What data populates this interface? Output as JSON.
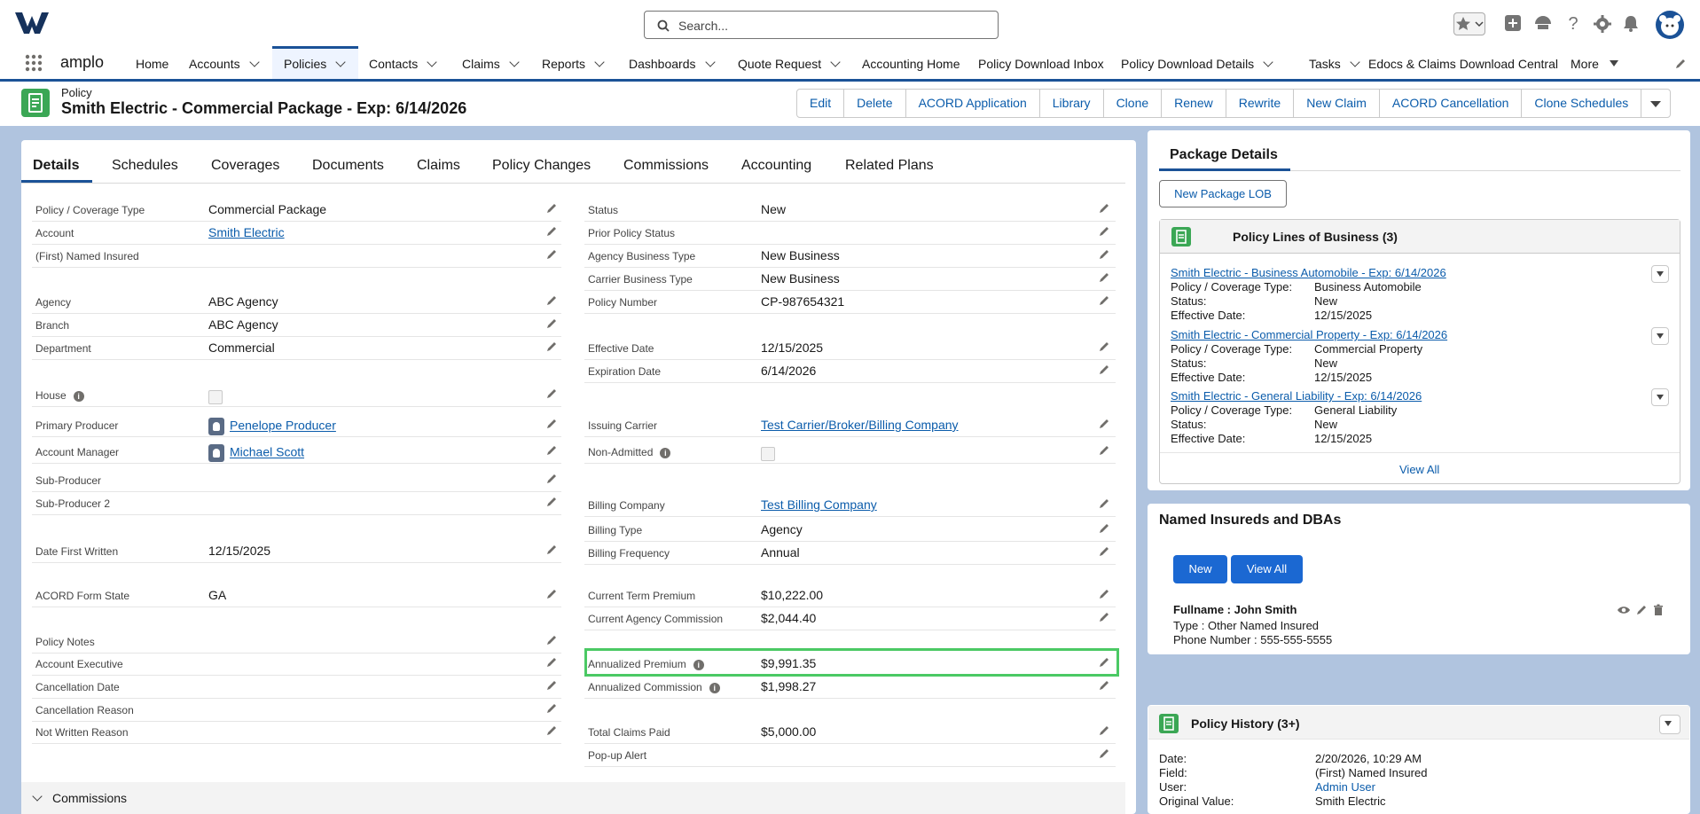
{
  "header": {
    "search_placeholder": "Search...",
    "app_name": "amplo"
  },
  "nav": {
    "items": [
      "Home",
      "Accounts",
      "Policies",
      "Contacts",
      "Claims",
      "Reports",
      "Dashboards",
      "Quote Request",
      "Accounting Home",
      "Policy Download Inbox",
      "Policy Download Details",
      "Tasks",
      "Edocs & Claims Download Central",
      "More"
    ]
  },
  "record": {
    "object_label": "Policy",
    "title": "Smith Electric - Commercial Package - Exp: 6/14/2026",
    "actions": [
      "Edit",
      "Delete",
      "ACORD Application",
      "Library",
      "Clone",
      "Renew",
      "Rewrite",
      "New Claim",
      "ACORD Cancellation",
      "Clone Schedules"
    ]
  },
  "tabs": [
    "Details",
    "Schedules",
    "Coverages",
    "Documents",
    "Claims",
    "Policy Changes",
    "Commissions",
    "Accounting",
    "Related Plans"
  ],
  "left_fields": [
    {
      "label": "Policy / Coverage Type",
      "value": "Commercial Package"
    },
    {
      "label": "Account",
      "value": "Smith Electric"
    },
    {
      "label": "(First) Named Insured",
      "value": ""
    },
    {
      "label": "Agency",
      "value": "ABC Agency"
    },
    {
      "label": "Branch",
      "value": "ABC Agency"
    },
    {
      "label": "Department",
      "value": "Commercial"
    },
    {
      "label": "House",
      "value": ""
    },
    {
      "label": "Primary Producer",
      "value": "Penelope Producer"
    },
    {
      "label": "Account Manager",
      "value": "Michael Scott"
    },
    {
      "label": "Sub-Producer",
      "value": ""
    },
    {
      "label": "Sub-Producer 2",
      "value": ""
    },
    {
      "label": "Date First Written",
      "value": "12/15/2025"
    },
    {
      "label": "ACORD Form State",
      "value": "GA"
    },
    {
      "label": "Policy Notes",
      "value": ""
    },
    {
      "label": "Account Executive",
      "value": ""
    },
    {
      "label": "Cancellation Date",
      "value": ""
    },
    {
      "label": "Cancellation Reason",
      "value": ""
    },
    {
      "label": "Not Written Reason",
      "value": ""
    }
  ],
  "right_fields": [
    {
      "label": "Status",
      "value": "New"
    },
    {
      "label": "Prior Policy Status",
      "value": ""
    },
    {
      "label": "Agency Business Type",
      "value": "New Business"
    },
    {
      "label": "Carrier Business Type",
      "value": "New Business"
    },
    {
      "label": "Policy Number",
      "value": "CP-987654321"
    },
    {
      "label": "Effective Date",
      "value": "12/15/2025"
    },
    {
      "label": "Expiration Date",
      "value": "6/14/2026"
    },
    {
      "label": "Issuing Carrier",
      "value": "Test Carrier/Broker/Billing Company"
    },
    {
      "label": "Non-Admitted",
      "value": ""
    },
    {
      "label": "Billing Company",
      "value": "Test Billing Company"
    },
    {
      "label": "Billing Type",
      "value": "Agency"
    },
    {
      "label": "Billing Frequency",
      "value": "Annual"
    },
    {
      "label": "Current Term Premium",
      "value": "$10,222.00"
    },
    {
      "label": "Current Agency Commission",
      "value": "$2,044.40"
    },
    {
      "label": "Annualized Premium",
      "value": "$9,991.35"
    },
    {
      "label": "Annualized Commission",
      "value": "$1,998.27"
    },
    {
      "label": "Total Claims Paid",
      "value": "$5,000.00"
    },
    {
      "label": "Pop-up Alert",
      "value": ""
    }
  ],
  "commissions_section": "Commissions",
  "package": {
    "title": "Package Details",
    "new_button": "New Package LOB",
    "lob_header": "Policy Lines of Business (3)",
    "field_labels": [
      "Policy / Coverage Type:",
      "Status:",
      "Effective Date:"
    ],
    "lobs": [
      {
        "name": "Smith Electric - Business Automobile - Exp: 6/14/2026",
        "type": "Business Automobile",
        "status": "New",
        "effective": "12/15/2025"
      },
      {
        "name": "Smith Electric - Commercial Property - Exp: 6/14/2026",
        "type": "Commercial Property",
        "status": "New",
        "effective": "12/15/2025"
      },
      {
        "name": "Smith Electric - General Liability - Exp: 6/14/2026",
        "type": "General Liability",
        "status": "New",
        "effective": "12/15/2025"
      }
    ],
    "view_all": "View All"
  },
  "named_insureds": {
    "title": "Named Insureds and DBAs",
    "new_button": "New",
    "view_all_button": "View All",
    "fullname": "Fullname : John Smith",
    "type": "Type : Other Named Insured",
    "phone": "Phone Number : 555-555-5555"
  },
  "history": {
    "title": "Policy History (3+)",
    "labels": [
      "Date:",
      "Field:",
      "User:",
      "Original Value:"
    ],
    "values": [
      "2/20/2026, 10:29 AM",
      "(First) Named Insured",
      "Admin User",
      "Smith Electric"
    ]
  },
  "colors": {
    "brand": "#1b5297",
    "highlight": "#4bc964",
    "record_icon": "#3ba755",
    "link": "#0b5cab"
  }
}
